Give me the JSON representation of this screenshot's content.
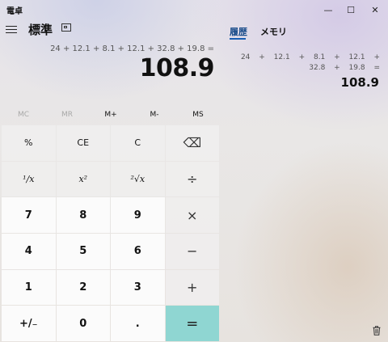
{
  "window": {
    "title": "電卓",
    "minimize": "—",
    "maximize": "☐",
    "close": "✕"
  },
  "header": {
    "mode": "標準"
  },
  "display": {
    "expression": "24 + 12.1 + 8.1 + 12.1 + 32.8 + 19.8 =",
    "result": "108.9"
  },
  "memory": [
    "MC",
    "MR",
    "M+",
    "M-",
    "MS"
  ],
  "keys": {
    "percent": "%",
    "ce": "CE",
    "clear": "C",
    "backspace": "⌫",
    "reciprocal": "¹/x",
    "square": "x²",
    "sqrt": "²√x",
    "divide": "÷",
    "seven": "7",
    "eight": "8",
    "nine": "9",
    "multiply": "×",
    "four": "4",
    "five": "5",
    "six": "6",
    "minus": "−",
    "one": "1",
    "two": "2",
    "three": "3",
    "plus": "+",
    "negate": "+/₋",
    "zero": "0",
    "decimal": ".",
    "equals": "="
  },
  "side_panel": {
    "tabs": {
      "history": "履歴",
      "memory": "メモリ"
    },
    "history": [
      {
        "expression": "24 + 12.1 + 8.1 + 12.1 + 32.8 + 19.8 =",
        "result": "108.9"
      }
    ]
  }
}
